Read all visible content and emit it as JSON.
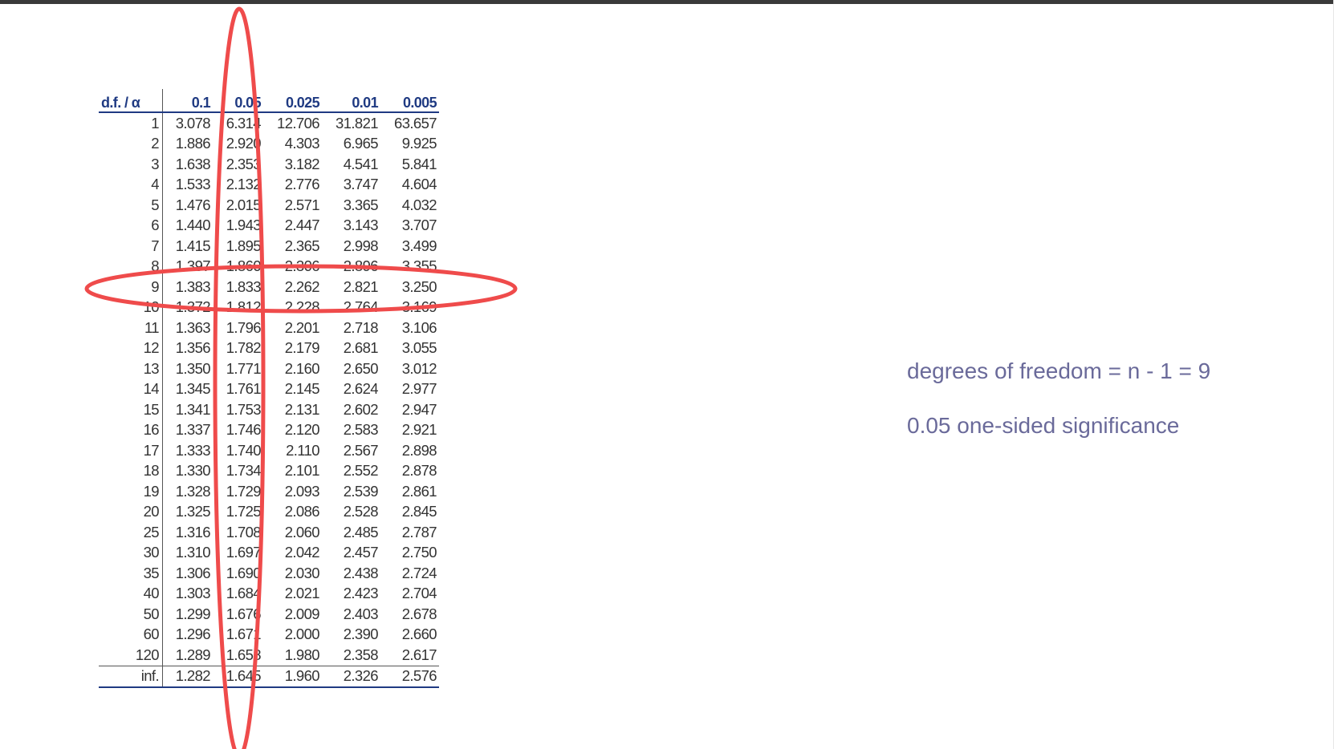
{
  "table": {
    "header": [
      "d.f. / α",
      "0.1",
      "0.05",
      "0.025",
      "0.01",
      "0.005"
    ],
    "rows": [
      [
        "1",
        "3.078",
        "6.314",
        "12.706",
        "31.821",
        "63.657"
      ],
      [
        "2",
        "1.886",
        "2.920",
        "4.303",
        "6.965",
        "9.925"
      ],
      [
        "3",
        "1.638",
        "2.353",
        "3.182",
        "4.541",
        "5.841"
      ],
      [
        "4",
        "1.533",
        "2.132",
        "2.776",
        "3.747",
        "4.604"
      ],
      [
        "5",
        "1.476",
        "2.015",
        "2.571",
        "3.365",
        "4.032"
      ],
      [
        "6",
        "1.440",
        "1.943",
        "2.447",
        "3.143",
        "3.707"
      ],
      [
        "7",
        "1.415",
        "1.895",
        "2.365",
        "2.998",
        "3.499"
      ],
      [
        "8",
        "1.397",
        "1.860",
        "2.306",
        "2.896",
        "3.355"
      ],
      [
        "9",
        "1.383",
        "1.833",
        "2.262",
        "2.821",
        "3.250"
      ],
      [
        "10",
        "1.372",
        "1.812",
        "2.228",
        "2.764",
        "3.169"
      ],
      [
        "11",
        "1.363",
        "1.796",
        "2.201",
        "2.718",
        "3.106"
      ],
      [
        "12",
        "1.356",
        "1.782",
        "2.179",
        "2.681",
        "3.055"
      ],
      [
        "13",
        "1.350",
        "1.771",
        "2.160",
        "2.650",
        "3.012"
      ],
      [
        "14",
        "1.345",
        "1.761",
        "2.145",
        "2.624",
        "2.977"
      ],
      [
        "15",
        "1.341",
        "1.753",
        "2.131",
        "2.602",
        "2.947"
      ],
      [
        "16",
        "1.337",
        "1.746",
        "2.120",
        "2.583",
        "2.921"
      ],
      [
        "17",
        "1.333",
        "1.740",
        "2.110",
        "2.567",
        "2.898"
      ],
      [
        "18",
        "1.330",
        "1.734",
        "2.101",
        "2.552",
        "2.878"
      ],
      [
        "19",
        "1.328",
        "1.729",
        "2.093",
        "2.539",
        "2.861"
      ],
      [
        "20",
        "1.325",
        "1.725",
        "2.086",
        "2.528",
        "2.845"
      ],
      [
        "25",
        "1.316",
        "1.708",
        "2.060",
        "2.485",
        "2.787"
      ],
      [
        "30",
        "1.310",
        "1.697",
        "2.042",
        "2.457",
        "2.750"
      ],
      [
        "35",
        "1.306",
        "1.690",
        "2.030",
        "2.438",
        "2.724"
      ],
      [
        "40",
        "1.303",
        "1.684",
        "2.021",
        "2.423",
        "2.704"
      ],
      [
        "50",
        "1.299",
        "1.676",
        "2.009",
        "2.403",
        "2.678"
      ],
      [
        "60",
        "1.296",
        "1.671",
        "2.000",
        "2.390",
        "2.660"
      ],
      [
        "120",
        "1.289",
        "1.658",
        "1.980",
        "2.358",
        "2.617"
      ],
      [
        "inf.",
        "1.282",
        "1.645",
        "1.960",
        "2.326",
        "2.576"
      ]
    ]
  },
  "highlights": {
    "column": "0.05",
    "row": "9",
    "color": "#ef4b4b"
  },
  "notes": {
    "line1": "degrees of freedom = n - 1 = 9",
    "line2": "0.05 one-sided significance"
  },
  "colors": {
    "header": "#1f3a82",
    "notes": "#6a6a9a",
    "highlight": "#ef4b4b"
  }
}
